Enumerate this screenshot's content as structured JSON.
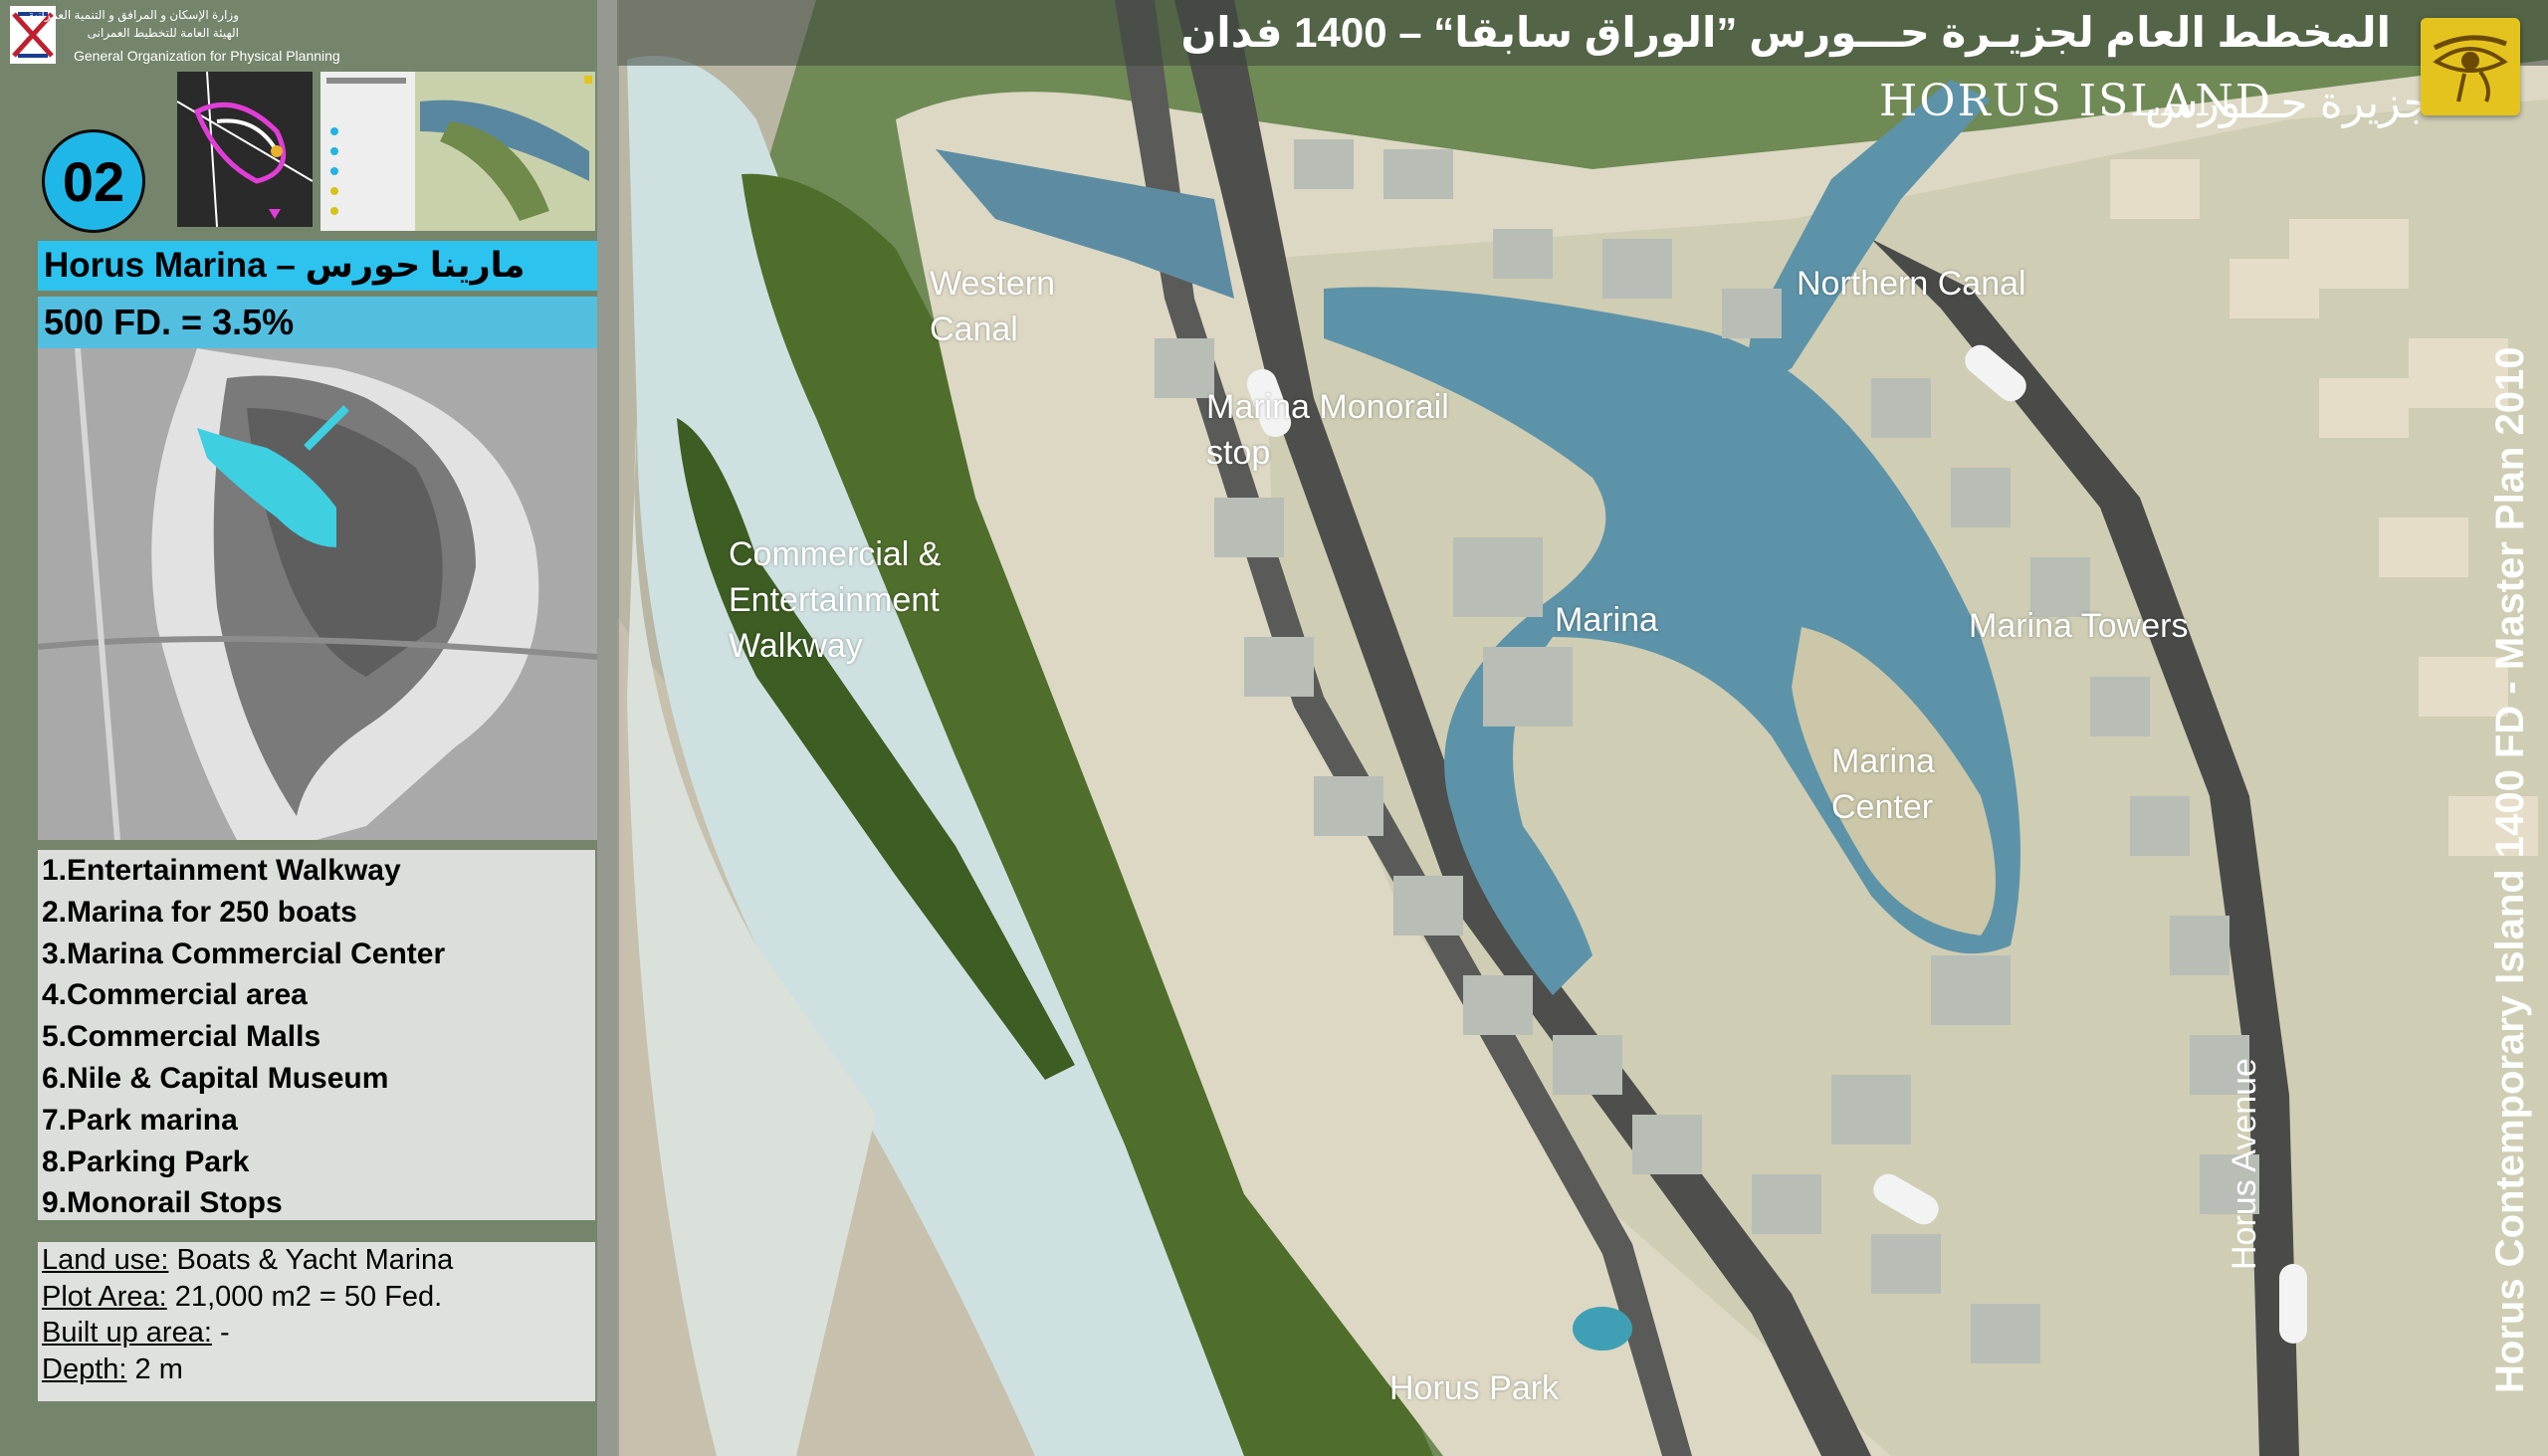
{
  "header": {
    "title_arabic": "المخطط العام لجزيـرة حـــورس ”الوراق سابقا“ – 1400 فدان",
    "logo_text": "HORUS ISLAND",
    "logo_arabic": "جزيرة حـــورس",
    "badge_icon": "eye-of-horus-icon"
  },
  "organization": {
    "ministry_arabic": "وزارة الإسكان و المرافق و التنمية العمرانية",
    "org_arabic": "الهيئة العامة للتخطيط العمرانى",
    "org_english": "General Organization for Physical Planning"
  },
  "project": {
    "number": "02",
    "title": "Horus Marina – مارينا حورس",
    "area": "500 FD. = 3.5%"
  },
  "features": [
    "1.Entertainment Walkway",
    "2.Marina for 250 boats",
    "3.Marina Commercial Center",
    "4.Commercial area",
    "5.Commercial Malls",
    "6.Nile & Capital Museum",
    "7.Park marina",
    "8.Parking Park",
    "9.Monorail Stops"
  ],
  "info": {
    "land_use_label": "Land use:",
    "land_use_value": " Boats & Yacht Marina",
    "plot_area_label": "Plot Area:",
    "plot_area_value": " 21,000 m2 = 50 Fed.",
    "built_up_label": "Built up area:",
    "built_up_value": " -",
    "depth_label": "Depth:",
    "depth_value": " 2 m"
  },
  "map_labels": {
    "western_canal": "Western\nCanal",
    "northern_canal": "Northern Canal",
    "monorail_stop": "Marina Monorail\nstop",
    "walkway": "Commercial &\nEntertainment\nWalkway",
    "marina": "Marina",
    "marina_towers": "Marina Towers",
    "marina_center": "Marina\nCenter",
    "horus_park": "Horus Park",
    "horus_avenue": "Horus Avenue"
  },
  "side_caption": "Horus Contemporary Island 1400 FD - Master Plan 2010",
  "colors": {
    "accent_cyan": "#2dc3ef",
    "badge_yellow": "#e5c31f",
    "water": "#5d93a8",
    "green": "#5a7a2f"
  }
}
